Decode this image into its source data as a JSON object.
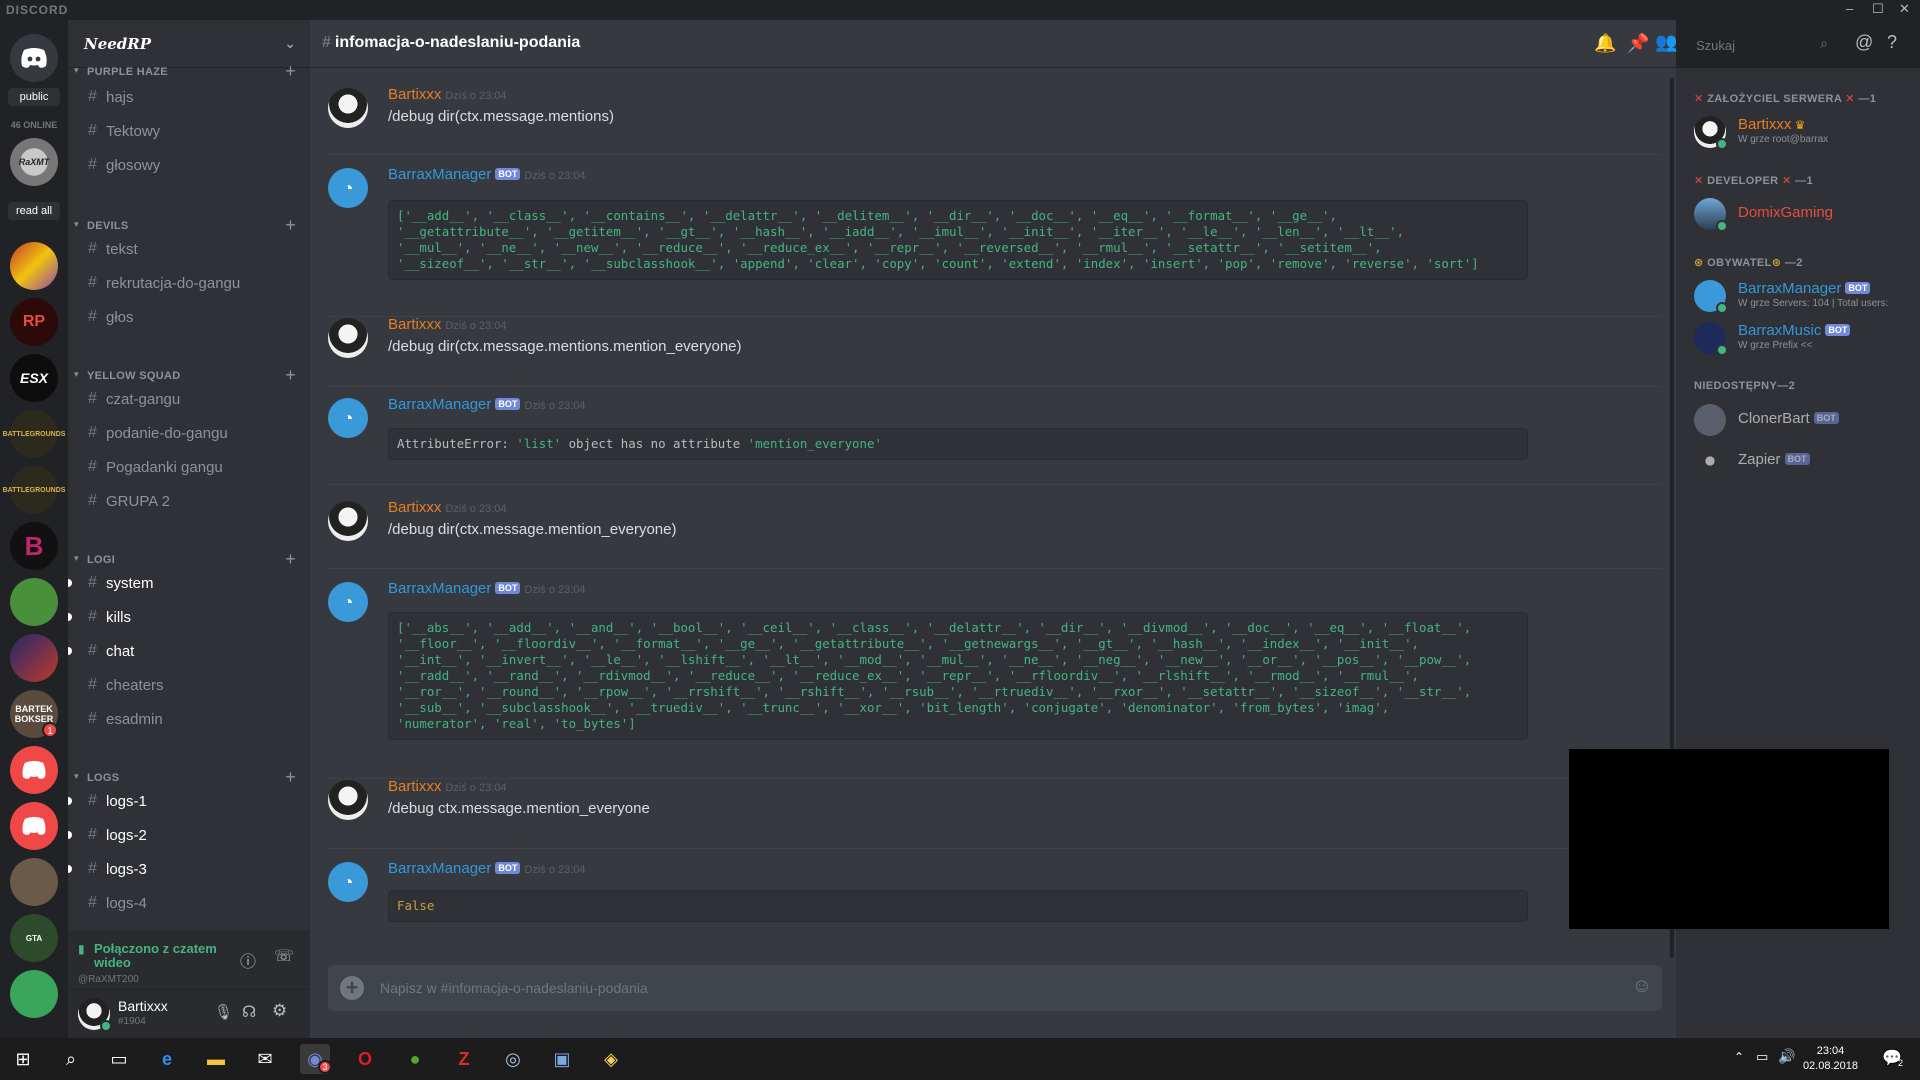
{
  "app": {
    "brand": "DISCORD"
  },
  "guilds": {
    "public_label": "public",
    "online_count": "46 ONLINE",
    "read_all_label": "read all",
    "server_initials": [
      "RaXMT",
      "",
      "",
      "ESX",
      "",
      "",
      "B",
      "",
      "",
      "BARTEK BOKSER",
      "",
      "",
      "",
      "",
      ""
    ],
    "badge_bartek": "1"
  },
  "server": {
    "name": "NeedRP",
    "categories": [
      {
        "name": "PURPLE HAZE",
        "channels": [
          "hajs",
          "Tektowy",
          "głosowy"
        ]
      },
      {
        "name": "DEVILS",
        "channels": [
          "tekst",
          "rekrutacja-do-gangu",
          "głos"
        ]
      },
      {
        "name": "YELLOW SQUAD",
        "channels": [
          "czat-gangu",
          "podanie-do-gangu",
          "Pogadanki gangu",
          "GRUPA 2"
        ]
      },
      {
        "name": "LOGI",
        "channels": [
          "system",
          "kills",
          "chat",
          "cheaters",
          "esadmin"
        ]
      },
      {
        "name": "LOGS",
        "channels": [
          "logs-1",
          "logs-2",
          "logs-3",
          "logs-4"
        ]
      }
    ]
  },
  "voice": {
    "status": "Połączono z czatem wideo",
    "sub": "@RaXMT200"
  },
  "user": {
    "name": "Bartixxx",
    "tag": "#1904"
  },
  "chat": {
    "channel_name": "infomacja-o-nadeslaniu-podania",
    "search_placeholder": "Szukaj",
    "composer_placeholder": "Napisz w #infomacja-o-nadeslaniu-podania",
    "bot_tag": "BOT",
    "messages": [
      {
        "author": "Bartixxx",
        "time": "Dziś o 23:04",
        "text": "/debug dir(ctx.message.mentions)"
      },
      {
        "author": "BarraxManager",
        "time": "Dziś o 23:04",
        "code": "['__add__', '__class__', '__contains__', '__delattr__', '__delitem__', '__dir__', '__doc__', '__eq__', '__format__', '__ge__',\n'__getattribute__', '__getitem__', '__gt__', '__hash__', '__iadd__', '__imul__', '__init__', '__iter__', '__le__', '__len__', '__lt__',\n'__mul__', '__ne__', '__new__', '__reduce__', '__reduce_ex__', '__repr__', '__reversed__', '__rmul__', '__setattr__', '__setitem__',\n'__sizeof__', '__str__', '__subclasshook__', 'append', 'clear', 'copy', 'count', 'extend', 'index', 'insert', 'pop', 'remove', 'reverse', 'sort']"
      },
      {
        "author": "Bartixxx",
        "time": "Dziś o 23:04",
        "text": "/debug dir(ctx.message.mentions.mention_everyone)"
      },
      {
        "author": "BarraxManager",
        "time": "Dziś o 23:04",
        "error_prefix": "AttributeError: ",
        "error_str1": "'list'",
        "error_mid": " object has no attribute ",
        "error_str2": "'mention_everyone'"
      },
      {
        "author": "Bartixxx",
        "time": "Dziś o 23:04",
        "text": "/debug dir(ctx.message.mention_everyone)"
      },
      {
        "author": "BarraxManager",
        "time": "Dziś o 23:04",
        "code": "['__abs__', '__add__', '__and__', '__bool__', '__ceil__', '__class__', '__delattr__', '__dir__', '__divmod__', '__doc__', '__eq__', '__float__',\n'__floor__', '__floordiv__', '__format__', '__ge__', '__getattribute__', '__getnewargs__', '__gt__', '__hash__', '__index__', '__init__',\n'__int__', '__invert__', '__le__', '__lshift__', '__lt__', '__mod__', '__mul__', '__ne__', '__neg__', '__new__', '__or__', '__pos__', '__pow__',\n'__radd__', '__rand__', '__rdivmod__', '__reduce__', '__reduce_ex__', '__repr__', '__rfloordiv__', '__rlshift__', '__rmod__', '__rmul__',\n'__ror__', '__round__', '__rpow__', '__rrshift__', '__rshift__', '__rsub__', '__rtruediv__', '__rxor__', '__setattr__', '__sizeof__', '__str__',\n'__sub__', '__subclasshook__', '__truediv__', '__trunc__', '__xor__', 'bit_length', 'conjugate', 'denominator', 'from_bytes', 'imag',\n'numerator', 'real', 'to_bytes']"
      },
      {
        "author": "Bartixxx",
        "time": "Dziś o 23:04",
        "text": "/debug ctx.message.mention_everyone"
      },
      {
        "author": "BarraxManager",
        "time": "Dziś o 23:04",
        "code": "False"
      }
    ]
  },
  "members": {
    "groups": [
      {
        "label": "ZAŁOŻYCIEL SERWERA",
        "count": "—1",
        "members": [
          {
            "name": "Bartixxx",
            "status": "W grze root@barrax"
          }
        ]
      },
      {
        "label": "DEVELOPER",
        "count": "—1",
        "members": [
          {
            "name": "DomixGaming",
            "status": ""
          }
        ]
      },
      {
        "label": "OBYWATEL",
        "count": "—2",
        "members": [
          {
            "name": "BarraxManager",
            "status": "W grze Servers: 104 | Total users:"
          },
          {
            "name": "BarraxMusic",
            "status": "W grze Prefix <<"
          }
        ]
      },
      {
        "label": "NIEDOSTĘPNY",
        "count": "—2",
        "members": [
          {
            "name": "ClonerBart",
            "status": ""
          },
          {
            "name": "Zapier",
            "status": ""
          }
        ]
      }
    ]
  },
  "taskbar": {
    "time": "23:04",
    "date": "02.08.2018",
    "notif_count": "2",
    "discord_badge": "3"
  },
  "colors": {
    "owner": "#e67e22",
    "bot": "#3498db",
    "developer": "#e74c3c",
    "online": "#43b581",
    "code": "#43b581",
    "blurple": "#7289da"
  }
}
